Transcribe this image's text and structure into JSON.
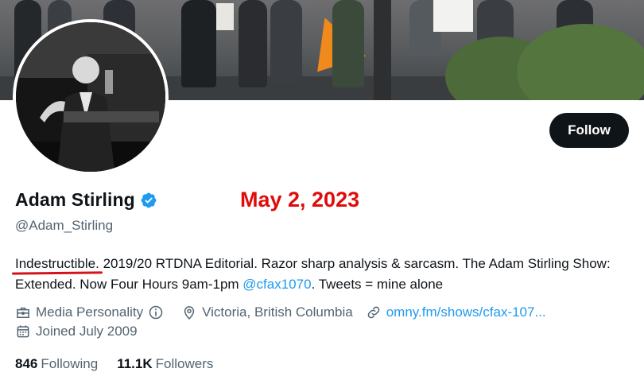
{
  "profile": {
    "display_name": "Adam Stirling",
    "handle": "@Adam_Stirling",
    "follow_label": "Follow",
    "annotation_date": "May 2, 2023",
    "bio_underlined": "Indestructible.",
    "bio_part1": " 2019/20 RTDNA Editorial. Razor sharp analysis & sarcasm. The Adam Stirling Show: Extended. Now Four Hours 9am-1pm ",
    "bio_link": "@cfax1070",
    "bio_part2": ". Tweets = mine alone",
    "category": "Media Personality",
    "location": "Victoria, British Columbia",
    "website": "omny.fm/shows/cfax-107...",
    "joined": "Joined July 2009",
    "following_count": "846",
    "following_label": "Following",
    "followers_count": "11.1K",
    "followers_label": "Followers"
  },
  "colors": {
    "accent_link": "#1d9bf0",
    "verified_badge": "#1d9bf0",
    "annotation_red": "#e00b0b",
    "follow_button_bg": "#0f1419",
    "secondary_text": "#536471"
  },
  "icons": {
    "verified": "verified-badge-icon",
    "category": "briefcase-icon",
    "info": "info-icon",
    "location": "location-pin-icon",
    "website": "link-icon",
    "joined": "calendar-icon"
  }
}
